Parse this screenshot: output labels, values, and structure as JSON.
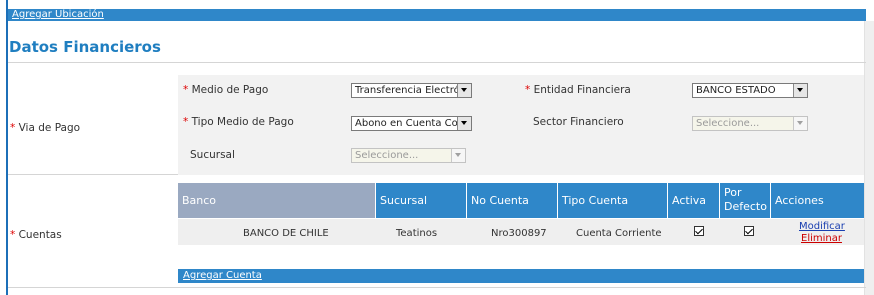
{
  "header": {
    "add_location_link": "Agregar Ubicación"
  },
  "section": {
    "title": "Datos Financieros"
  },
  "payment": {
    "side_label": "Via de Pago",
    "required_mark": "*",
    "medio_pago": {
      "label": "Medio de Pago",
      "value": "Transferencia Electró"
    },
    "entidad": {
      "label": "Entidad Financiera",
      "value": "BANCO ESTADO"
    },
    "tipo_medio": {
      "label": "Tipo Medio de Pago",
      "value": "Abono en Cuenta Cor"
    },
    "sector": {
      "label": "Sector Financiero",
      "value": "Seleccione..."
    },
    "sucursal": {
      "label": "Sucursal",
      "value": "Seleccione..."
    }
  },
  "accounts": {
    "side_label": "Cuentas",
    "headers": {
      "banco": "Banco",
      "sucursal": "Sucursal",
      "no_cuenta": "No Cuenta",
      "tipo_cuenta": "Tipo Cuenta",
      "activa": "Activa",
      "por_defecto_1": "Por",
      "por_defecto_2": "Defecto",
      "acciones": "Acciones"
    },
    "rows": [
      {
        "banco": "BANCO DE CHILE",
        "sucursal": "Teatinos",
        "no_cuenta": "Nro300897",
        "tipo_cuenta": "Cuenta Corriente",
        "activa": true,
        "por_defecto": true,
        "modify_label": "Modificar",
        "delete_label": "Eliminar"
      }
    ],
    "add_account_link": "Agregar Cuenta"
  },
  "colors": {
    "accent": "#2f87c9",
    "title": "#1f7ec0",
    "required": "#dd0000",
    "bank_header": "#9aa9c1",
    "delete_link": "#cc0000",
    "modify_link": "#1a3fb0"
  },
  "icons": [
    "dropdown-arrow-icon",
    "checkbox-checked-icon"
  ]
}
